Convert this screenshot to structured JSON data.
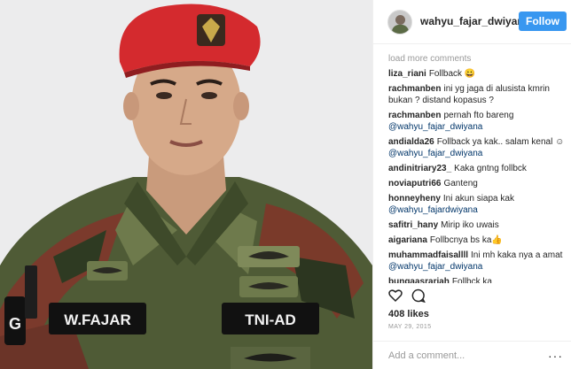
{
  "post": {
    "username": "wahyu_fajar_dwiyana",
    "follow_label": "Follow",
    "load_more": "load more comments",
    "likes": "408 likes",
    "date": "MAY 29, 2015",
    "add_comment_placeholder": "Add a comment...",
    "more_icon": "···"
  },
  "photo": {
    "name_tag": "W.FAJAR",
    "unit_tag": "TNI-AD",
    "shoulder_letter": "G"
  },
  "comments": [
    {
      "user": "liza_riani",
      "text": "Follback 😀",
      "mention": ""
    },
    {
      "user": "rachmanben",
      "text": "ini yg jaga di alusista kmrin bukan ? distand kopasus ?",
      "mention": ""
    },
    {
      "user": "rachmanben",
      "text": "pernah fto bareng",
      "mention": "@wahyu_fajar_dwiyana"
    },
    {
      "user": "andialda26",
      "text": "Follback ya kak.. salam kenal ☺",
      "mention": "@wahyu_fajar_dwiyana"
    },
    {
      "user": "andinitriary23_",
      "text": "Kaka gntng follbck",
      "mention": ""
    },
    {
      "user": "noviaputri66",
      "text": "Ganteng",
      "mention": ""
    },
    {
      "user": "honneyheny",
      "text": "Ini akun siapa kak",
      "mention": "@wahyu_fajardwiyana"
    },
    {
      "user": "safitri_hany",
      "text": "Mirip iko uwais",
      "mention": ""
    },
    {
      "user": "aigariana",
      "text": "Follbcnya bs ka👍",
      "mention": ""
    },
    {
      "user": "muhammadfaisallll",
      "text": "Ini mh kaka nya a amat",
      "mention": "@wahyu_fajar_dwiyana"
    },
    {
      "user": "bungaasrariah",
      "text": "Follbck ka",
      "mention": ""
    }
  ],
  "colors": {
    "follow_bg": "#3897f0",
    "beret": "#d42a2e",
    "camo_green": "#4a5a32"
  }
}
